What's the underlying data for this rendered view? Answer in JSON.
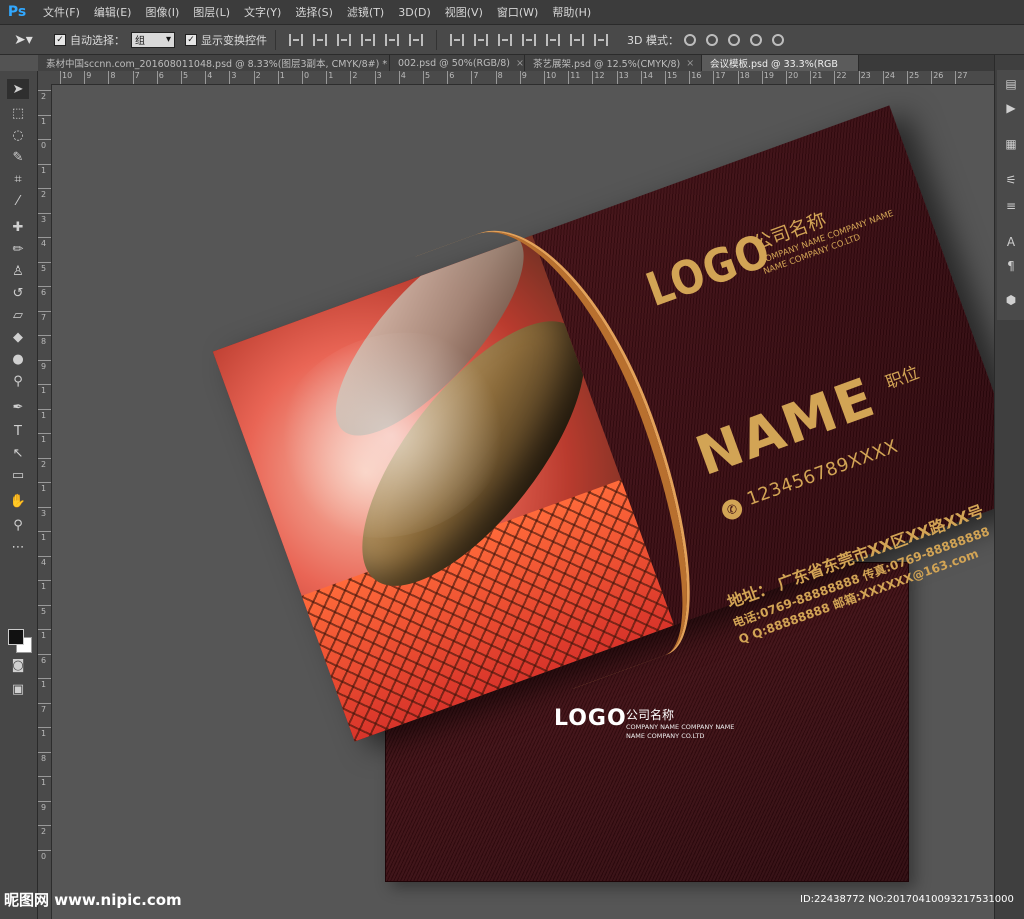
{
  "app": {
    "logo": "Ps"
  },
  "menu": [
    "文件(F)",
    "编辑(E)",
    "图像(I)",
    "图层(L)",
    "文字(Y)",
    "选择(S)",
    "滤镜(T)",
    "3D(D)",
    "视图(V)",
    "窗口(W)",
    "帮助(H)"
  ],
  "options": {
    "auto_select_label": "自动选择：",
    "auto_select_value": "组",
    "show_transform_label": "显示变换控件",
    "mode3d_label": "3D 模式："
  },
  "tabs": [
    {
      "label": "素材中国sccnn.com_201608011048.psd @ 8.33%(图层3副本, CMYK/8#) *",
      "active": false
    },
    {
      "label": "002.psd @ 50%(RGB/8)",
      "active": false
    },
    {
      "label": "茶艺展架.psd @ 12.5%(CMYK/8)",
      "active": false
    },
    {
      "label": "会议模板.psd @ 33.3%(RGB",
      "active": true
    }
  ],
  "ruler_h": [
    "10",
    "9",
    "8",
    "7",
    "6",
    "5",
    "4",
    "3",
    "2",
    "1",
    "0",
    "1",
    "2",
    "3",
    "4",
    "5",
    "6",
    "7",
    "8",
    "9",
    "10",
    "11",
    "12",
    "13",
    "14",
    "15",
    "16",
    "17",
    "18",
    "19",
    "20",
    "21",
    "22",
    "23",
    "24",
    "25",
    "26",
    "27"
  ],
  "ruler_v": [
    "2",
    "1",
    "0",
    "1",
    "2",
    "3",
    "4",
    "5",
    "6",
    "7",
    "8",
    "9",
    "1",
    "1",
    "1",
    "2",
    "1",
    "3",
    "1",
    "4",
    "1",
    "5",
    "1",
    "6",
    "1",
    "7",
    "1",
    "8",
    "1",
    "9",
    "2",
    "0"
  ],
  "card_front": {
    "logo": "LOGO",
    "company_cn": "公司名称",
    "company_en_1": "COMPANY NAME COMPANY NAME",
    "company_en_2": "NAME COMPANY CO.LTD",
    "name": "NAME",
    "title": "职位",
    "phone": "123456789XXXX",
    "address": "地址：  广东省东莞市XX区XX路XX号",
    "contact_line1": "电话:0769-88888888   传真:0769-88888888",
    "contact_line2": "Q Q:88888888   邮箱:XXXXXX@163.com",
    "email_inline": "XXXXXX@163.com"
  },
  "card_back": {
    "logo": "LOGO",
    "company_cn": "公司名称",
    "company_en_1": "COMPANY NAME COMPANY NAME",
    "company_en_2": "NAME COMPANY CO.LTD"
  },
  "watermark": {
    "left": "昵图网 www.nipic.com",
    "right": "ID:22438772 NO:20170410093217531000"
  },
  "colors": {
    "gold": "#d2a455",
    "maroon": "#3a0c12",
    "ui_bg": "#535353"
  }
}
